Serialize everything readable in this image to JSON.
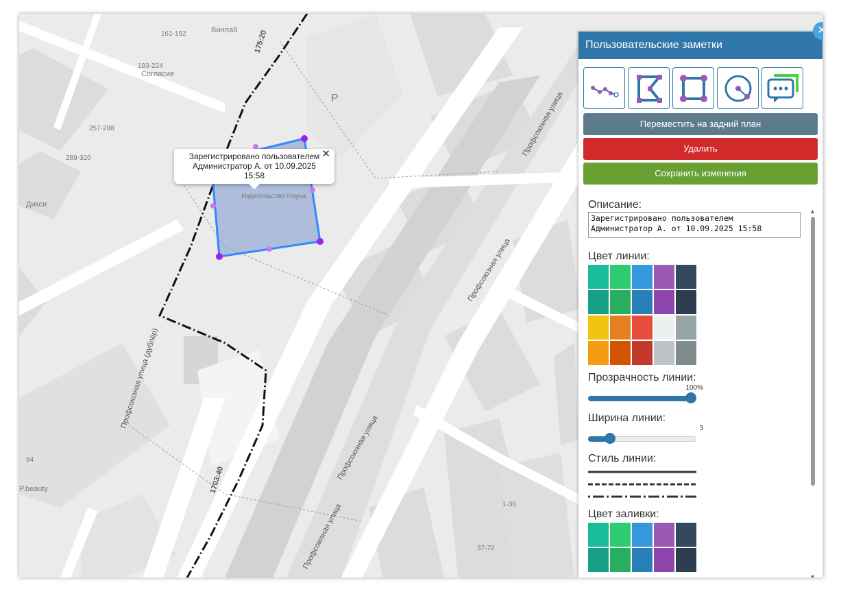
{
  "map": {
    "pois": {
      "vinlab": "Винлаб",
      "soglasie": "Согласие",
      "diksi": "Дикси",
      "publisher": "Издательство Наука",
      "pbeauty": "P.beauty",
      "parking": "P"
    },
    "house_numbers": {
      "h1": "161-192",
      "h2": "193-224",
      "h3": "257-288",
      "h4": "289-320",
      "h5": "94",
      "h6": "1-36",
      "h7": "37-72"
    },
    "streets": {
      "s1": "Профсоюзная улица",
      "s2": "Профсоюзная улица",
      "s3": "Профсоюзная улица",
      "s4": "Профсоюзная улица",
      "s5": "Профсоюзная улица (дублёр)"
    },
    "boundary_labels": {
      "b1": "175:20",
      "b2": "1703:40"
    },
    "popup": {
      "text": "Зарегистрировано пользователем Администратор А. от 10.09.2025 15:58",
      "close": "✕"
    }
  },
  "panel": {
    "title": "Пользовательские заметки",
    "close": "✕",
    "tools": [
      "polyline-tool",
      "polygon-tool",
      "rectangle-tool",
      "circle-tool",
      "comment-tool"
    ],
    "buttons": {
      "move_back": "Переместить на задний план",
      "delete": "Удалить",
      "save": "Сохранить изменения"
    },
    "description_label": "Описание:",
    "description_value": "Зарегистрировано пользователем Администратор А. от 10.09.2025 15:58",
    "line_color_label": "Цвет линии:",
    "line_opacity_label": "Прозрачность линии:",
    "line_opacity_value": "100%",
    "line_opacity_fraction": 1.0,
    "line_width_label": "Ширина линии:",
    "line_width_value": "3",
    "line_width_fraction": 0.17,
    "line_style_label": "Стиль линии:",
    "fill_color_label": "Цвет заливки:",
    "palette": [
      "#1abc9c",
      "#2ecc71",
      "#3498db",
      "#9b59b6",
      "#34495e",
      "#16a085",
      "#27ae60",
      "#2980b9",
      "#8e44ad",
      "#2c3e50",
      "#f1c40f",
      "#e67e22",
      "#e74c3c",
      "#ecf0f1",
      "#95a5a6",
      "#f39c12",
      "#d35400",
      "#c0392b",
      "#bdc3c7",
      "#7f8c8d"
    ],
    "accent": "#2f77a8",
    "polygon_color": "#3388ff",
    "vertex_color": "#a020f0"
  }
}
